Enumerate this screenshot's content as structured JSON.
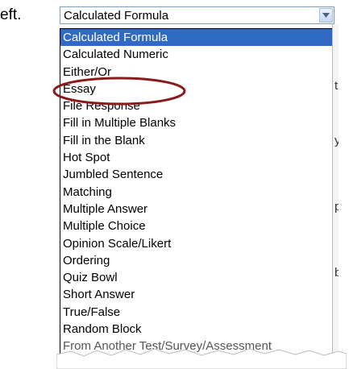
{
  "background": {
    "partial_text": "eft."
  },
  "select": {
    "value": "Calculated Formula"
  },
  "list": {
    "items": [
      "Calculated Formula",
      "Calculated Numeric",
      "Either/Or",
      "Essay",
      "File Response",
      "Fill in Multiple Blanks",
      "Fill in the Blank",
      "Hot Spot",
      "Jumbled Sentence",
      "Matching",
      "Multiple Answer",
      "Multiple Choice",
      "Opinion Scale/Likert",
      "Ordering",
      "Quiz Bowl",
      "Short Answer",
      "True/False",
      "Random Block",
      "From Another Test/Survey/Assessment"
    ],
    "selected_index": 0,
    "highlighted_item": "Essay"
  },
  "right_strip": {
    "chars": [
      "t",
      "y",
      "p",
      "b"
    ]
  },
  "colors": {
    "selection_bg": "#316ac5",
    "highlight_ellipse": "#8b1a1a"
  }
}
